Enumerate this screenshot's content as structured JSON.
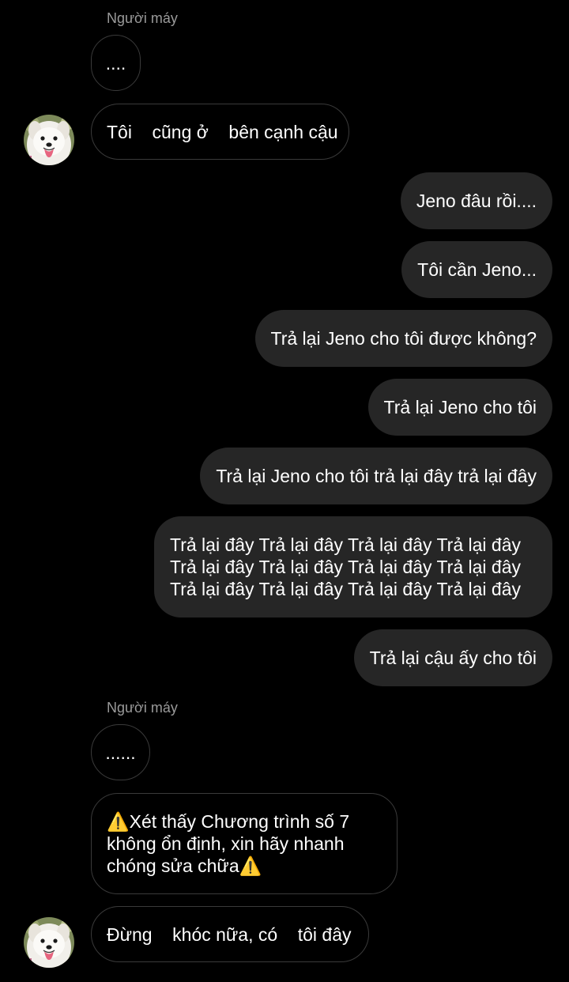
{
  "conversation": {
    "groups": [
      {
        "sender": "Người máy",
        "messages": [
          "....",
          "Tôi    cũng ở    bên cạnh cậu"
        ]
      },
      {
        "sender": "Người máy",
        "messages": [
          "......",
          "⚠️Xét thấy Chương trình số 7 không ổn định, xin hãy nhanh chóng sửa chữa⚠️",
          "Đừng    khóc nữa, có    tôi đây"
        ]
      }
    ],
    "outgoing": [
      "Jeno đâu rồi....",
      "Tôi cần Jeno...",
      "Trả lại Jeno cho tôi được không?",
      "Trả lại Jeno cho tôi",
      "Trả lại Jeno cho tôi trả lại đây trả lại đây",
      "Trả lại đây Trả lại đây Trả lại đây Trả lại đây Trả lại đây Trả lại đây Trả lại đây Trả lại đây Trả lại đây Trả lại đây Trả lại đây Trả lại đây",
      "Trả lại cậu ấy cho tôi"
    ]
  },
  "colors": {
    "background": "#000000",
    "incoming_border": "#3a3a3a",
    "outgoing_bubble": "#262626",
    "sender_name": "#9a9a9a",
    "text": "#ffffff"
  },
  "icons": {
    "avatar": "samoyed-dog-avatar"
  }
}
